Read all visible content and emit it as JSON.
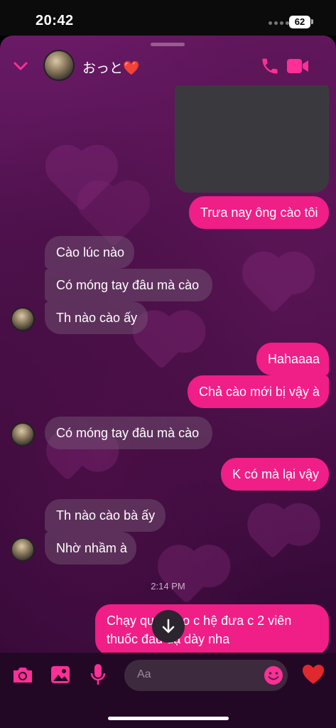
{
  "status_bar": {
    "time": "20:42",
    "battery": "62"
  },
  "header": {
    "contact_name": "おっと❤️"
  },
  "messages": [
    {
      "text": "Trưa nay ông cào tôi"
    },
    {
      "text": "Cào lúc nào"
    },
    {
      "text": "Có móng tay đâu mà cào"
    },
    {
      "text": "Th nào cào ấy"
    },
    {
      "text": "Hahaaaa"
    },
    {
      "text": "Chả cào mới bị vậy à"
    },
    {
      "text": "Có móng tay đâu mà cào"
    },
    {
      "text": "K có mà lại vậy"
    },
    {
      "text": "Th nào cào bà ấy"
    },
    {
      "text": "Nhờ nhầm à"
    },
    {
      "text_line1": "Chạy qu   ố bảo c hệ đưa c 2 viên",
      "text_line2": "thuốc đau   dạ dày nha"
    }
  ],
  "timestamp": "2:14 PM",
  "composer": {
    "placeholder": "Aa"
  },
  "colors": {
    "accent": "#f01e87",
    "background": "#3c0b3d"
  }
}
